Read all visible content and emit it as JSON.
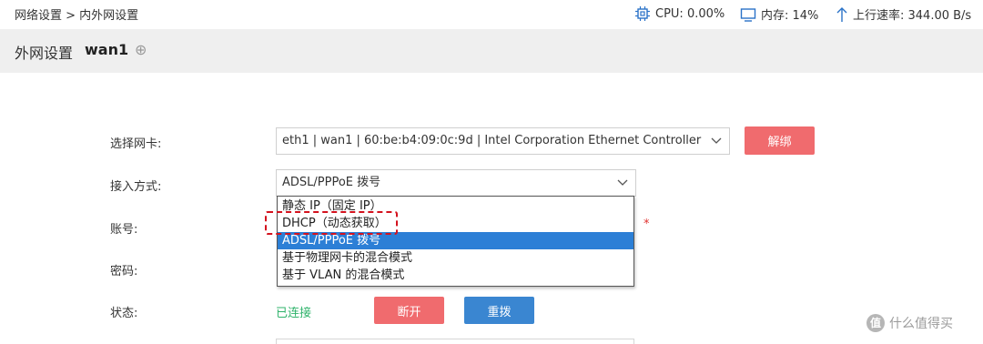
{
  "breadcrumb": "网络设置 > 内外网设置",
  "stats": {
    "cpu": "CPU: 0.00%",
    "memory": "内存: 14%",
    "upload": "上行速率: 344.00 B/s"
  },
  "header": {
    "title": "外网设置",
    "name": "wan1",
    "plus": "⊕"
  },
  "form": {
    "nic_label": "选择网卡:",
    "nic_value": "eth1 | wan1 | 60:be:b4:09:0c:9d | Intel Corporation Ethernet Controller",
    "unbind_button": "解绑",
    "access_label": "接入方式:",
    "access_value": "ADSL/PPPoE 拨号",
    "account_label": "账号:",
    "required_mark": "*",
    "password_label": "密码:",
    "status_label": "状态:",
    "status_value": "已连接",
    "disconnect_button": "断开",
    "redial_button": "重拨"
  },
  "dropdown": {
    "options": [
      "静态 IP（固定 IP）",
      "DHCP（动态获取）",
      "ADSL/PPPoE 拨号",
      "基于物理网卡的混合模式",
      "基于 VLAN 的混合模式"
    ],
    "selected_index": 2
  },
  "watermark": {
    "icon": "值",
    "text": "什么值得买"
  },
  "colors": {
    "header_band": "#efefef",
    "unbind_button": "#f06b6e",
    "disconnect_button": "#f06b6e",
    "redial_button": "#3a86d1",
    "selected_option": "#2c7fd6",
    "status_connected": "#2fb36b",
    "highlight_dash": "#d4121e",
    "icon_blue": "#2a72c8"
  }
}
